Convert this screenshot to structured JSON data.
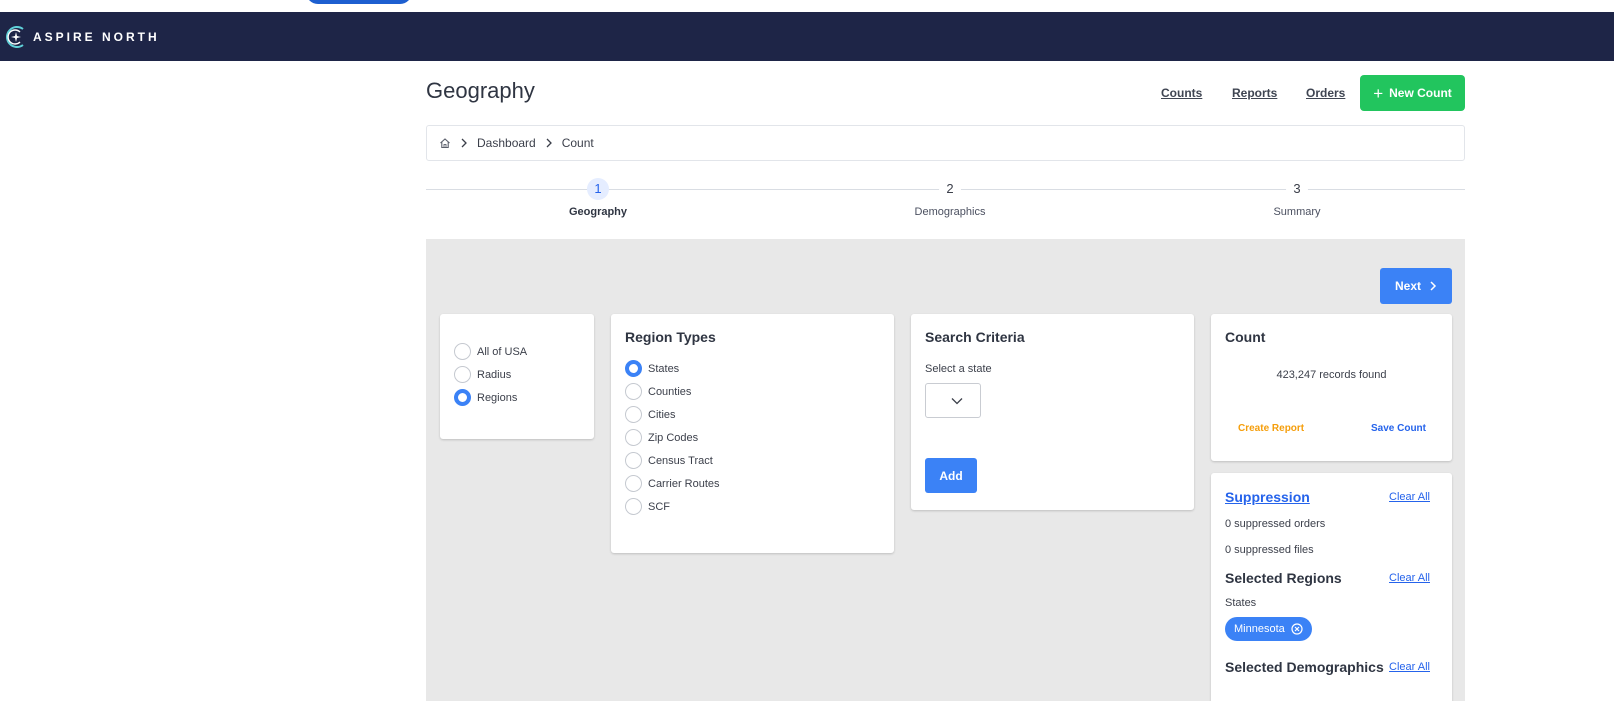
{
  "brand": {
    "name": "ASPIRE NORTH"
  },
  "header": {
    "title": "Geography",
    "links": [
      "Counts",
      "Reports",
      "Orders"
    ],
    "new_count_label": "New Count"
  },
  "breadcrumb": {
    "items": [
      "Dashboard",
      "Count"
    ]
  },
  "stepper": {
    "steps": [
      {
        "number": "1",
        "label": "Geography",
        "active": true
      },
      {
        "number": "2",
        "label": "Demographics",
        "active": false
      },
      {
        "number": "3",
        "label": "Summary",
        "active": false
      }
    ]
  },
  "next_label": "Next",
  "scope": {
    "options": [
      {
        "label": "All of USA",
        "checked": false
      },
      {
        "label": "Radius",
        "checked": false
      },
      {
        "label": "Regions",
        "checked": true
      }
    ]
  },
  "region_types": {
    "title": "Region Types",
    "options": [
      {
        "label": "States",
        "checked": true
      },
      {
        "label": "Counties",
        "checked": false
      },
      {
        "label": "Cities",
        "checked": false
      },
      {
        "label": "Zip Codes",
        "checked": false
      },
      {
        "label": "Census Tract",
        "checked": false
      },
      {
        "label": "Carrier Routes",
        "checked": false
      },
      {
        "label": "SCF",
        "checked": false
      }
    ]
  },
  "search_criteria": {
    "title": "Search Criteria",
    "select_label": "Select a state",
    "selected_value": "",
    "add_label": "Add"
  },
  "count": {
    "title": "Count",
    "records_text": "423,247 records found",
    "create_report_label": "Create Report",
    "save_count_label": "Save Count"
  },
  "suppression": {
    "title": "Suppression",
    "clear_label": "Clear All",
    "orders_text": "0 suppressed orders",
    "files_text": "0 suppressed files",
    "selected_regions_title": "Selected Regions",
    "regions_clear_label": "Clear All",
    "region_type_label": "States",
    "chip_label": "Minnesota",
    "selected_demographics_title": "Selected Demographics",
    "demographics_clear_label": "Clear All"
  },
  "colors": {
    "navbar": "#1e2547",
    "accent_blue": "#3b82f6",
    "green": "#22c55e",
    "orange": "#f59e0b",
    "panel_bg": "#e8e8e8"
  }
}
